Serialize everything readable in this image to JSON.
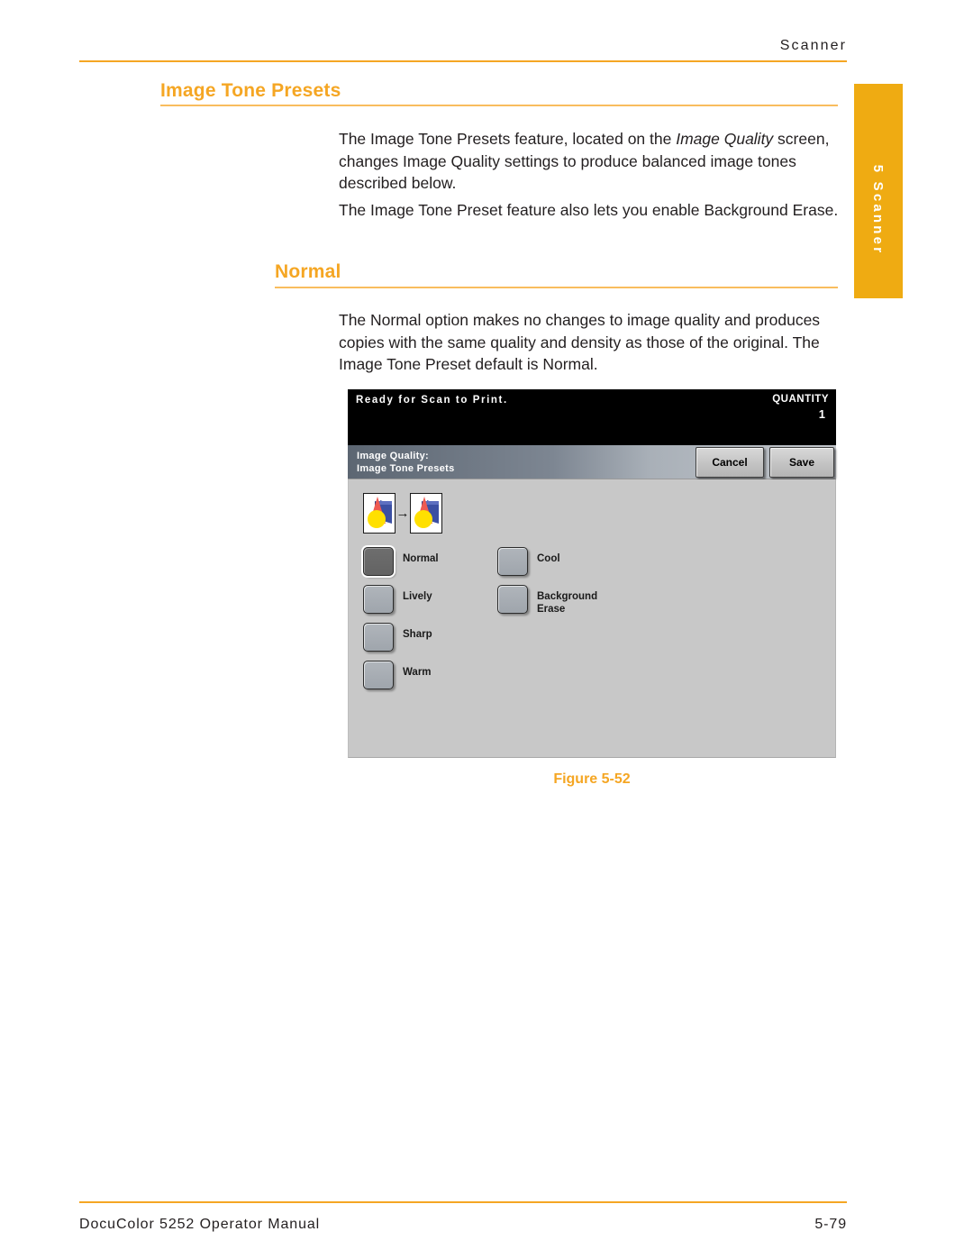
{
  "page": {
    "running_head": "Scanner",
    "section_tab": "5 Scanner",
    "accent_color": "#f5a623",
    "tab_color": "#efab12"
  },
  "headings": {
    "level1": "Image Tone Presets",
    "level2": "Normal"
  },
  "paragraphs": {
    "p1_before_italic": "The Image Tone Presets feature, located on the ",
    "p1_italic": "Image Quality",
    "p1_after_italic": " screen, changes Image Quality settings to produce balanced image tones described below.",
    "p2": "The Image Tone Preset feature also lets you enable Background Erase.",
    "p3": "The Normal option makes no changes to image quality and produces copies with the same quality and density as those of the original. The Image Tone Preset default is Normal."
  },
  "figure": {
    "caption": "Figure 5-52",
    "screen": {
      "status_message": "Ready for Scan to Print.",
      "quantity_label": "QUANTITY",
      "quantity_value": "1",
      "title_line1": "Image Quality:",
      "title_line2": "Image Tone Presets",
      "cancel_label": "Cancel",
      "save_label": "Save",
      "preview_icon": "image-tone-preview-icon",
      "arrow_icon": "→",
      "options_column_1": [
        {
          "label": "Normal",
          "selected": true
        },
        {
          "label": "Lively",
          "selected": false
        },
        {
          "label": "Sharp",
          "selected": false
        },
        {
          "label": "Warm",
          "selected": false
        }
      ],
      "options_column_2": [
        {
          "label": "Cool",
          "selected": false
        },
        {
          "label": "Background\nErase",
          "selected": false
        }
      ]
    }
  },
  "footer": {
    "manual_title": "DocuColor 5252 Operator Manual",
    "page_number": "5-79"
  }
}
